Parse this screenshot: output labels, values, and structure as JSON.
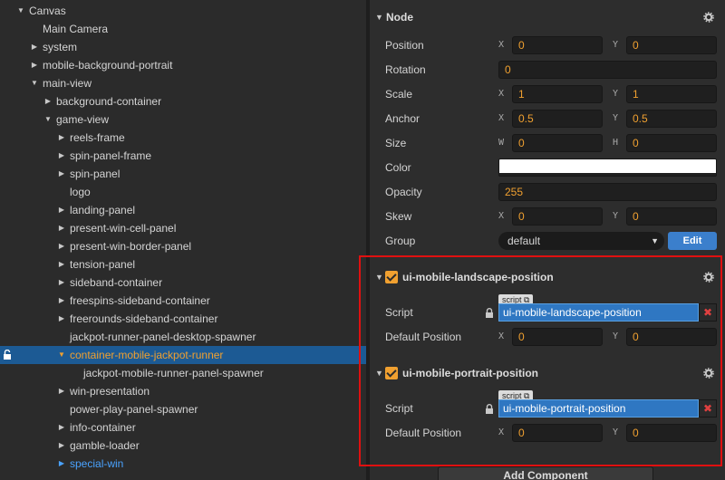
{
  "hierarchy": {
    "rows": [
      {
        "label": "Canvas",
        "arrow": "▼",
        "depth": 0
      },
      {
        "label": "Main Camera",
        "arrow": "",
        "depth": 1
      },
      {
        "label": "system",
        "arrow": "▶",
        "depth": 1
      },
      {
        "label": "mobile-background-portrait",
        "arrow": "▶",
        "depth": 1
      },
      {
        "label": "main-view",
        "arrow": "▼",
        "depth": 1
      },
      {
        "label": "background-container",
        "arrow": "▶",
        "depth": 2
      },
      {
        "label": "game-view",
        "arrow": "▼",
        "depth": 2
      },
      {
        "label": "reels-frame",
        "arrow": "▶",
        "depth": 3
      },
      {
        "label": "spin-panel-frame",
        "arrow": "▶",
        "depth": 3
      },
      {
        "label": "spin-panel",
        "arrow": "▶",
        "depth": 3
      },
      {
        "label": "logo",
        "arrow": "",
        "depth": 3
      },
      {
        "label": "landing-panel",
        "arrow": "▶",
        "depth": 3
      },
      {
        "label": "present-win-cell-panel",
        "arrow": "▶",
        "depth": 3
      },
      {
        "label": "present-win-border-panel",
        "arrow": "▶",
        "depth": 3
      },
      {
        "label": "tension-panel",
        "arrow": "▶",
        "depth": 3
      },
      {
        "label": "sideband-container",
        "arrow": "▶",
        "depth": 3
      },
      {
        "label": "freespins-sideband-container",
        "arrow": "▶",
        "depth": 3
      },
      {
        "label": "freerounds-sideband-container",
        "arrow": "▶",
        "depth": 3
      },
      {
        "label": "jackpot-runner-panel-desktop-spawner",
        "arrow": "",
        "depth": 3
      },
      {
        "label": "container-mobile-jackpot-runner",
        "arrow": "▼",
        "depth": 3,
        "selected": true
      },
      {
        "label": "jackpot-mobile-runner-panel-spawner",
        "arrow": "",
        "depth": 4
      },
      {
        "label": "win-presentation",
        "arrow": "▶",
        "depth": 3
      },
      {
        "label": "power-play-panel-spawner",
        "arrow": "",
        "depth": 3
      },
      {
        "label": "info-container",
        "arrow": "▶",
        "depth": 3
      },
      {
        "label": "gamble-loader",
        "arrow": "▶",
        "depth": 3
      },
      {
        "label": "special-win",
        "arrow": "▶",
        "depth": 3,
        "link": true
      }
    ]
  },
  "inspector": {
    "node": {
      "title": "Node",
      "position": {
        "label": "Position",
        "x_axis": "X",
        "x": "0",
        "y_axis": "Y",
        "y": "0"
      },
      "rotation": {
        "label": "Rotation",
        "value": "0"
      },
      "scale": {
        "label": "Scale",
        "x_axis": "X",
        "x": "1",
        "y_axis": "Y",
        "y": "1"
      },
      "anchor": {
        "label": "Anchor",
        "x_axis": "X",
        "x": "0.5",
        "y_axis": "Y",
        "y": "0.5"
      },
      "size": {
        "label": "Size",
        "w_axis": "W",
        "w": "0",
        "h_axis": "H",
        "h": "0"
      },
      "color": {
        "label": "Color",
        "value": "#ffffff"
      },
      "opacity": {
        "label": "Opacity",
        "value": "255"
      },
      "skew": {
        "label": "Skew",
        "x_axis": "X",
        "x": "0",
        "y_axis": "Y",
        "y": "0"
      },
      "group": {
        "label": "Group",
        "value": "default",
        "edit_label": "Edit"
      }
    },
    "components": [
      {
        "title": "ui-mobile-landscape-position",
        "script_tag": "script",
        "script_label": "Script",
        "script_value": "ui-mobile-landscape-position",
        "default_position_label": "Default Position",
        "x_axis": "X",
        "x": "0",
        "y_axis": "Y",
        "y": "0"
      },
      {
        "title": "ui-mobile-portrait-position",
        "script_tag": "script",
        "script_label": "Script",
        "script_value": "ui-mobile-portrait-position",
        "default_position_label": "Default Position",
        "x_axis": "X",
        "x": "0",
        "y_axis": "Y",
        "y": "0"
      }
    ],
    "add_component_label": "Add Component"
  },
  "colors": {
    "accent": "#f0a030",
    "selection": "#1c5a94",
    "script_field": "#2f77c2",
    "highlight_border": "#e01010"
  }
}
